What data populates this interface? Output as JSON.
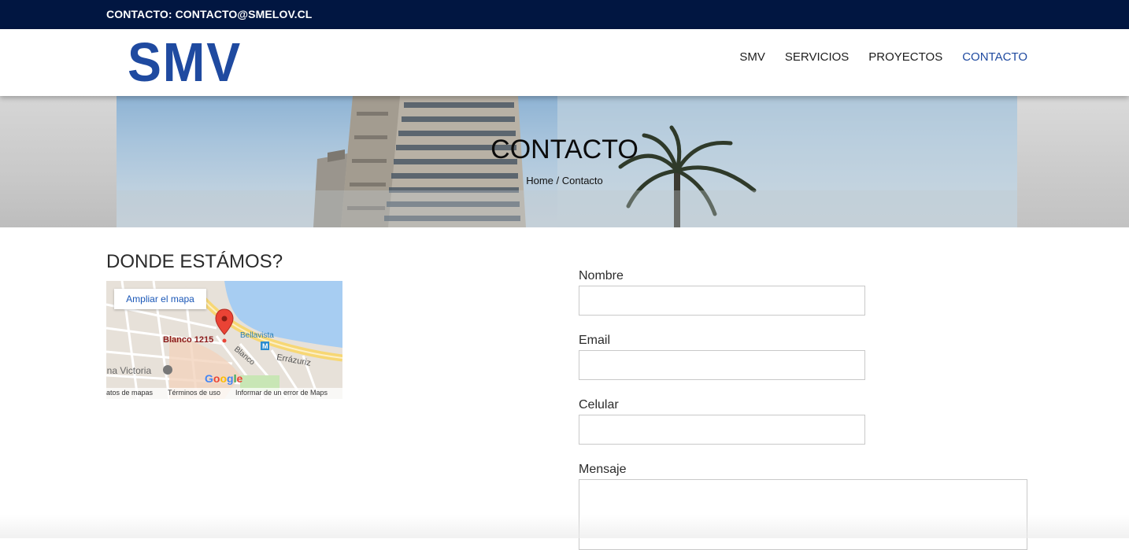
{
  "topbar": {
    "contact_text": "CONTACTO: CONTACTO@SMELOV.CL"
  },
  "header": {
    "logo_text": "SMV",
    "nav": [
      {
        "label": "SMV",
        "active": false
      },
      {
        "label": "SERVICIOS",
        "active": false
      },
      {
        "label": "PROYECTOS",
        "active": false
      },
      {
        "label": "CONTACTO",
        "active": true
      }
    ]
  },
  "hero": {
    "title": "CONTACTO",
    "breadcrumb": {
      "home": "Home",
      "separator": " / ",
      "current": "Contacto"
    }
  },
  "location": {
    "title": "DONDE ESTÁMOS?",
    "map": {
      "enlarge_label": "Ampliar el mapa",
      "place_label": "Blanco 1215",
      "labels": {
        "bellavista": "Bellavista",
        "blanco": "Blanco",
        "errazuriz": "Errázuriz",
        "victoria": "ina Victoria",
        "metro": "M"
      },
      "google": "Google",
      "footer": [
        "atos de mapas",
        "Términos de uso",
        "Informar de un error de Maps"
      ]
    }
  },
  "form": {
    "fields": [
      {
        "label": "Nombre",
        "value": ""
      },
      {
        "label": "Email",
        "value": ""
      },
      {
        "label": "Celular",
        "value": ""
      },
      {
        "label": "Mensaje",
        "value": ""
      }
    ]
  },
  "colors": {
    "topbar_bg": "#011641",
    "logo_blue": "#1f4aa0",
    "nav_active": "#1f4aa0",
    "nav_text": "#1d1d1d",
    "map_water": "#a7cdf2",
    "map_pin": "#ea4335"
  },
  "icons": [
    "map-pin-icon",
    "metro-station-icon",
    "google-logo"
  ]
}
